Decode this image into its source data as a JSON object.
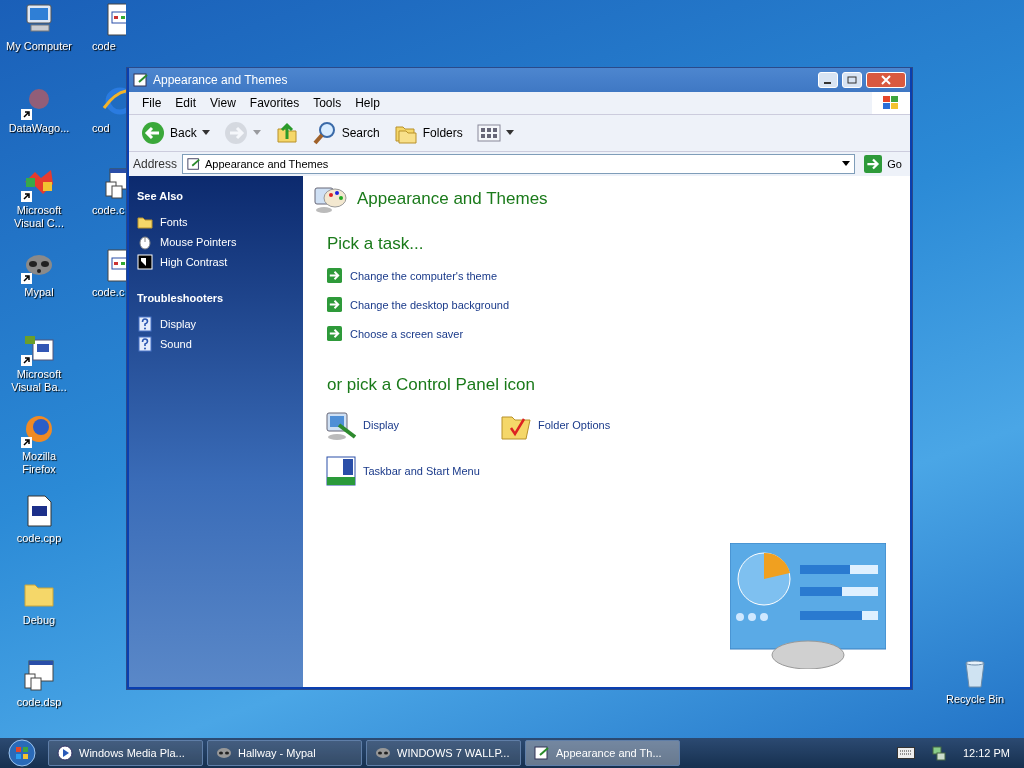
{
  "desktop": {
    "columns": [
      [
        {
          "label": "My Computer",
          "kind": "computer",
          "shortcut": false
        },
        {
          "label": "DataWago...",
          "kind": "generic",
          "shortcut": true
        },
        {
          "label": "Microsoft Visual C...",
          "kind": "studio",
          "shortcut": true
        },
        {
          "label": "Mypal",
          "kind": "raccoon",
          "shortcut": true
        },
        {
          "label": "Microsoft Visual Ba...",
          "kind": "vb",
          "shortcut": true
        },
        {
          "label": "Mozilla Firefox",
          "kind": "firefox",
          "shortcut": true
        },
        {
          "label": "code.cpp",
          "kind": "cpp",
          "shortcut": false
        },
        {
          "label": "Debug",
          "kind": "folder",
          "shortcut": false
        },
        {
          "label": "code.dsp",
          "kind": "multidoc",
          "shortcut": false
        }
      ],
      [
        {
          "label": "code",
          "kind": "window-doc",
          "shortcut": false
        },
        {
          "label": "cod",
          "kind": "ie",
          "shortcut": false
        },
        {
          "label": "code.c",
          "kind": "multidoc",
          "shortcut": false
        },
        {
          "label": "code.c",
          "kind": "window-doc",
          "shortcut": false
        }
      ]
    ],
    "recycle_bin": {
      "label": "Recycle Bin"
    }
  },
  "window": {
    "title": "Appearance and Themes",
    "menu": [
      "File",
      "Edit",
      "View",
      "Favorites",
      "Tools",
      "Help"
    ],
    "toolbar": [
      {
        "kind": "back",
        "label": "Back",
        "disabled": false
      },
      {
        "kind": "forward",
        "disabled": true
      },
      {
        "kind": "up",
        "disabled": false
      },
      {
        "kind": "search",
        "label": "Search",
        "disabled": false
      },
      {
        "kind": "folders",
        "label": "Folders",
        "disabled": false
      },
      {
        "kind": "views",
        "disabled": false
      }
    ],
    "address": {
      "label": "Address",
      "value": "Appearance and Themes",
      "go": "Go"
    },
    "sidebar": [
      {
        "title": "See Also",
        "items": [
          {
            "label": "Fonts",
            "kind": "folder"
          },
          {
            "label": "Mouse Pointers",
            "kind": "mouse"
          },
          {
            "label": "High Contrast",
            "kind": "contrast"
          }
        ]
      },
      {
        "title": "Troubleshooters",
        "items": [
          {
            "label": "Display",
            "kind": "help"
          },
          {
            "label": "Sound",
            "kind": "help"
          }
        ]
      }
    ],
    "content": {
      "heading": "Appearance and Themes",
      "task_title": "Pick a task...",
      "tasks": [
        "Change the computer's theme",
        "Change the desktop background",
        "Choose a screen saver"
      ],
      "icons_title": "or pick a Control Panel icon",
      "icons": [
        {
          "label": "Display",
          "kind": "display"
        },
        {
          "label": "Folder Options",
          "kind": "folder-options"
        },
        {
          "label": "Taskbar and Start Menu",
          "kind": "taskbar"
        }
      ]
    }
  },
  "taskbar": {
    "buttons": [
      {
        "label": "Windows Media Pla...",
        "kind": "media",
        "selected": false
      },
      {
        "label": "Hallway - Mypal",
        "kind": "raccoon",
        "selected": false
      },
      {
        "label": "WINDOWS 7 WALLP...",
        "kind": "raccoon",
        "selected": false
      },
      {
        "label": "Appearance and Th...",
        "kind": "cp",
        "selected": true
      }
    ],
    "clock": "12:12 PM"
  }
}
